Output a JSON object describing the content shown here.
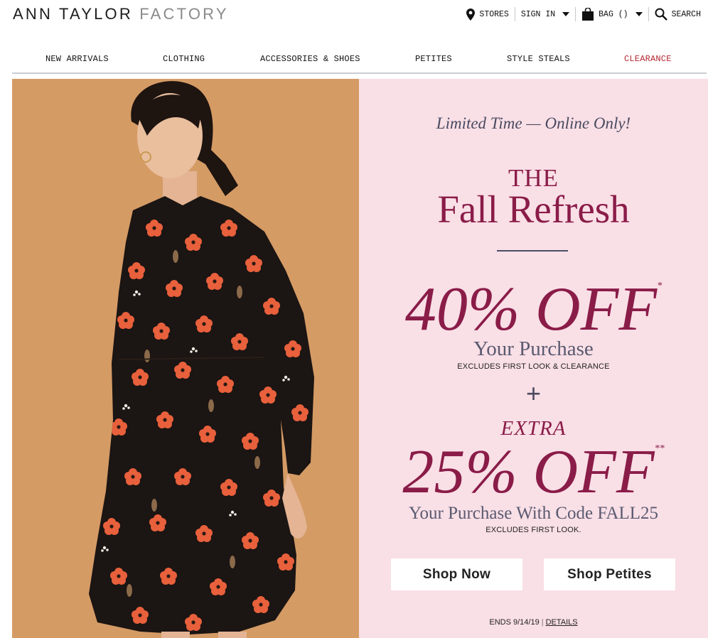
{
  "brand": {
    "word1": "ANN TAYLOR ",
    "word2": "FACTORY"
  },
  "utility": {
    "stores": "STORES",
    "sign_in": "SIGN IN",
    "bag": "BAG ()",
    "search": "SEARCH"
  },
  "nav": [
    {
      "label": "NEW ARRIVALS"
    },
    {
      "label": "CLOTHING"
    },
    {
      "label": "ACCESSORIES & SHOES"
    },
    {
      "label": "PETITES"
    },
    {
      "label": "STYLE STEALS"
    },
    {
      "label": "CLEARANCE"
    }
  ],
  "promo": {
    "tagline": "Limited Time — Online Only!",
    "title_small": "THE",
    "title_large": "Fall Refresh",
    "offer1": "40% OFF",
    "offer1_mark": "*",
    "offer1_sub": "Your Purchase",
    "offer1_fine": "EXCLUDES FIRST LOOK & CLEARANCE",
    "plus": "+",
    "extra": "EXTRA",
    "offer2": "25% OFF",
    "offer2_mark": "**",
    "offer2_sub": "Your Purchase With Code FALL25",
    "offer2_fine": "EXCLUDES FIRST LOOK.",
    "cta1": "Shop Now",
    "cta2": "Shop Petites",
    "ends": "ENDS 9/14/19",
    "separator": "|",
    "details": "DETAILS"
  },
  "colors": {
    "accent": "#8a1c48",
    "clearance": "#b3262f",
    "hero_bg": "#f9dfe6",
    "photo_bg": "#d59b65"
  },
  "icons": [
    "location-pin-icon",
    "caret-down-icon",
    "shopping-bag-icon",
    "search-icon"
  ]
}
